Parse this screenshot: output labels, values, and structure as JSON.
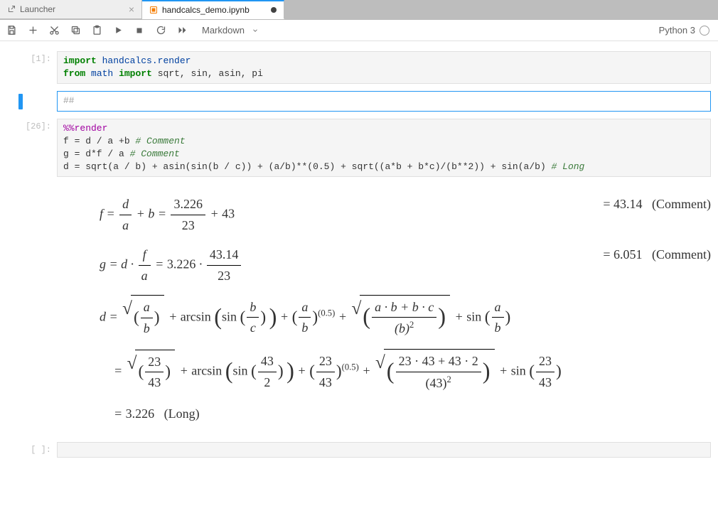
{
  "tabs": [
    {
      "label": "Launcher",
      "active": false,
      "dirty": false
    },
    {
      "label": "handcalcs_demo.ipynb",
      "active": true,
      "dirty": true
    }
  ],
  "toolbar": {
    "celltype": "Markdown",
    "kernel": "Python 3"
  },
  "cells": [
    {
      "prompt": "[1]:",
      "code": {
        "l1_kw1": "import",
        "l1_mod": "handcalcs.render",
        "l2_kw1": "from",
        "l2_mod": "math",
        "l2_kw2": "import",
        "l2_rest": "sqrt, sin, asin, pi"
      }
    },
    {
      "prompt": "",
      "placeholder": "##"
    },
    {
      "prompt": "[26]:",
      "code": {
        "magic": "%%render",
        "l1a": "f = d / a +b ",
        "l1c": "# Comment",
        "l2a": "g = d*f / a ",
        "l2c": "# Comment",
        "l3a": "d = sqrt(a / b) + asin(sin(b / c)) + (a/b)**(",
        "l3b": "0.5",
        "l3c": ") + sqrt((a*b + b*c)/(b**",
        "l3d": "2",
        "l3e": ")) + sin(a/b) ",
        "l3cm": "# Long"
      },
      "math": {
        "f_lhs": "f",
        "f_d": "d",
        "f_a1": "a",
        "f_plus": "+",
        "f_b": "b",
        "f_num1": "3.226",
        "f_den1": "23",
        "f_num2": "43",
        "f_res": "43.14",
        "f_comment": "(Comment)",
        "g_lhs": "g",
        "g_d": "d",
        "g_f": "f",
        "g_a": "a",
        "g_v1": "3.226",
        "g_num": "43.14",
        "g_den": "23",
        "g_res": "6.051",
        "g_comment": "(Comment)",
        "d_a": "a",
        "d_b": "b",
        "d_c": "c",
        "d_exp": "(0.5)",
        "d_abc_num": "a · b + b · c",
        "d_abc_den": "(b)",
        "d_23": "23",
        "d_43": "43",
        "d_2": "2",
        "d_num2": "23 · 43 + 43 · 2",
        "d_den2": "(43)",
        "d_res": "3.226",
        "d_long": "(Long)"
      }
    },
    {
      "prompt": "[ ]:"
    }
  ]
}
